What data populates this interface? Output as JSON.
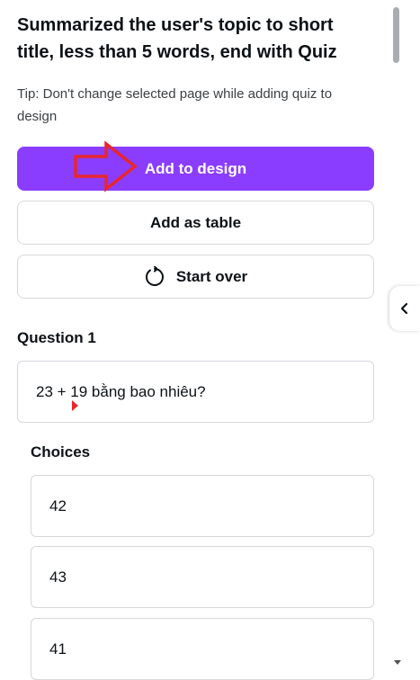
{
  "title": "Summarized the user's topic to short title, less than 5 words, end with Quiz",
  "tip": "Tip: Don't change selected page while adding quiz to design",
  "buttons": {
    "add_to_design": "Add to design",
    "add_as_table": "Add as table",
    "start_over": "Start over"
  },
  "question": {
    "label": "Question 1",
    "text": "23 + 19 bằng bao nhiêu?"
  },
  "choices": {
    "label": "Choices",
    "items": [
      "42",
      "43",
      "41"
    ]
  },
  "icons": {
    "restart": "restart-icon",
    "collapse": "chevron-left-icon",
    "annotation": "red-arrow-annotation"
  },
  "colors": {
    "primary": "#8b3dff",
    "annotation_red": "#e8262c",
    "border": "#d5d8dc"
  }
}
